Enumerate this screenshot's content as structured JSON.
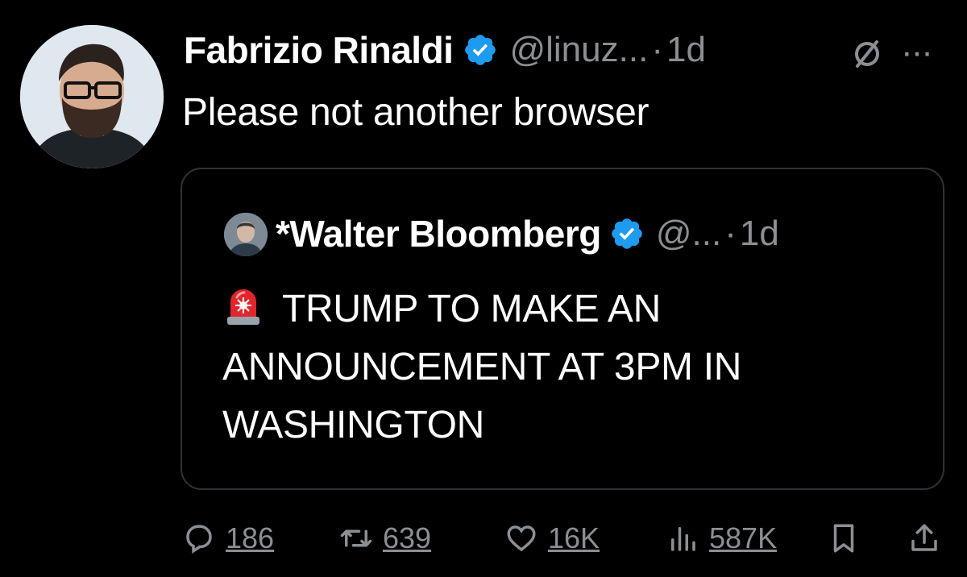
{
  "tweet": {
    "author_name": "Fabrizio Rinaldi",
    "handle": "@linuz...",
    "separator": "·",
    "time": "1d",
    "text": "Please not another browser",
    "more_label": "···"
  },
  "quote": {
    "author_name": "*Walter Bloomberg",
    "handle": "@...",
    "separator": "·",
    "time": "1d",
    "text": "TRUMP TO MAKE AN ANNOUNCEMENT AT 3PM IN WASHINGTON"
  },
  "actions": {
    "replies": "186",
    "reposts": "639",
    "likes": "16K",
    "views": "587K"
  },
  "icons": [
    "verified-badge-icon",
    "grok-icon",
    "more-icon",
    "siren-emoji-icon",
    "reply-icon",
    "repost-icon",
    "like-icon",
    "views-icon",
    "bookmark-icon",
    "share-icon"
  ],
  "colors": {
    "background": "#000000",
    "text": "#ffffff",
    "muted": "#8b8f94",
    "verified": "#1d9bf0",
    "border": "#2f3336"
  }
}
